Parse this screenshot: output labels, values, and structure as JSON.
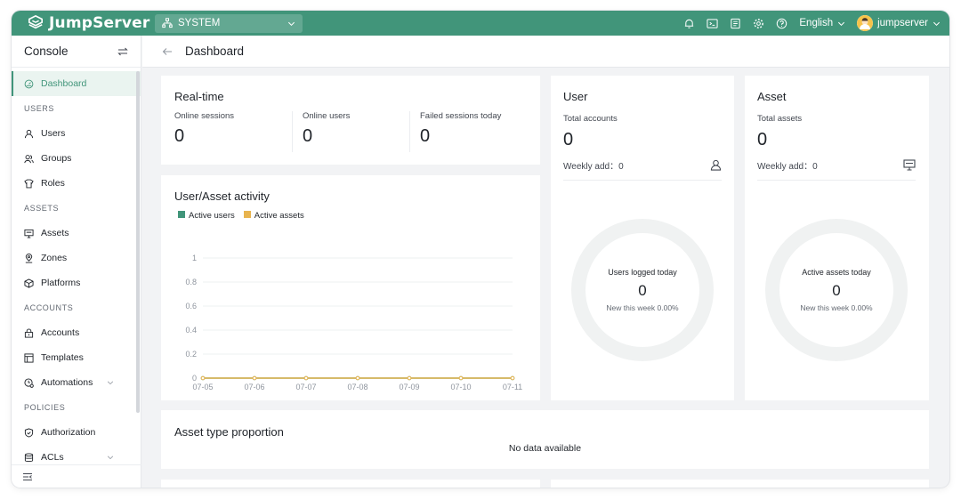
{
  "brand": {
    "name": "JumpServer",
    "accent": "#41957a"
  },
  "topbar": {
    "org": "SYSTEM",
    "icons": [
      "bell-icon",
      "terminal-icon",
      "notes-icon",
      "gear-icon",
      "help-icon"
    ],
    "language": "English",
    "username": "jumpserver"
  },
  "sidebar": {
    "title": "Console",
    "groups": [
      {
        "label": "",
        "items": [
          {
            "label": "Dashboard",
            "icon": "dashboard-icon",
            "active": true
          }
        ]
      },
      {
        "label": "USERS",
        "items": [
          {
            "label": "Users",
            "icon": "user-icon"
          },
          {
            "label": "Groups",
            "icon": "groups-icon"
          },
          {
            "label": "Roles",
            "icon": "roles-icon"
          }
        ]
      },
      {
        "label": "ASSETS",
        "items": [
          {
            "label": "Assets",
            "icon": "monitor-icon"
          },
          {
            "label": "Zones",
            "icon": "location-icon"
          },
          {
            "label": "Platforms",
            "icon": "cube-icon"
          }
        ]
      },
      {
        "label": "ACCOUNTS",
        "items": [
          {
            "label": "Accounts",
            "icon": "lock-icon"
          },
          {
            "label": "Templates",
            "icon": "template-icon"
          },
          {
            "label": "Automations",
            "icon": "automation-icon",
            "expandable": true
          }
        ]
      },
      {
        "label": "POLICIES",
        "items": [
          {
            "label": "Authorization",
            "icon": "shield-icon"
          },
          {
            "label": "ACLs",
            "icon": "acl-icon",
            "expandable": true
          }
        ]
      }
    ]
  },
  "header": {
    "title": "Dashboard"
  },
  "realtime": {
    "title": "Real-time",
    "stats": [
      {
        "label": "Online sessions",
        "value": "0"
      },
      {
        "label": "Online users",
        "value": "0"
      },
      {
        "label": "Failed sessions today",
        "value": "0"
      }
    ]
  },
  "activity": {
    "title": "User/Asset activity",
    "legend": [
      {
        "label": "Active users",
        "color": "#41957a"
      },
      {
        "label": "Active assets",
        "color": "#e8b44f"
      }
    ]
  },
  "chart_data": {
    "type": "line",
    "x": [
      "07-05",
      "07-06",
      "07-07",
      "07-08",
      "07-09",
      "07-10",
      "07-11"
    ],
    "series": [
      {
        "name": "Active users",
        "values": [
          0,
          0,
          0,
          0,
          0,
          0,
          0
        ],
        "color": "#41957a"
      },
      {
        "name": "Active assets",
        "values": [
          0,
          0,
          0,
          0,
          0,
          0,
          0
        ],
        "color": "#e8b44f"
      }
    ],
    "yticks": [
      "0",
      "0.2",
      "0.4",
      "0.6",
      "0.8",
      "1"
    ],
    "ylim": [
      0,
      1
    ],
    "grid": true
  },
  "user_card": {
    "title": "User",
    "total_label": "Total accounts",
    "total_value": "0",
    "weekly_label": "Weekly add：",
    "weekly_value": "0",
    "ring_title": "Users logged today",
    "ring_value": "0",
    "ring_sub": "New this week 0.00%"
  },
  "asset_card": {
    "title": "Asset",
    "total_label": "Total assets",
    "total_value": "0",
    "weekly_label": "Weekly add：",
    "weekly_value": "0",
    "ring_title": "Active assets today",
    "ring_value": "0",
    "ring_sub": "New this week 0.00%"
  },
  "asset_type": {
    "title": "Asset type proportion",
    "empty": "No data available"
  }
}
